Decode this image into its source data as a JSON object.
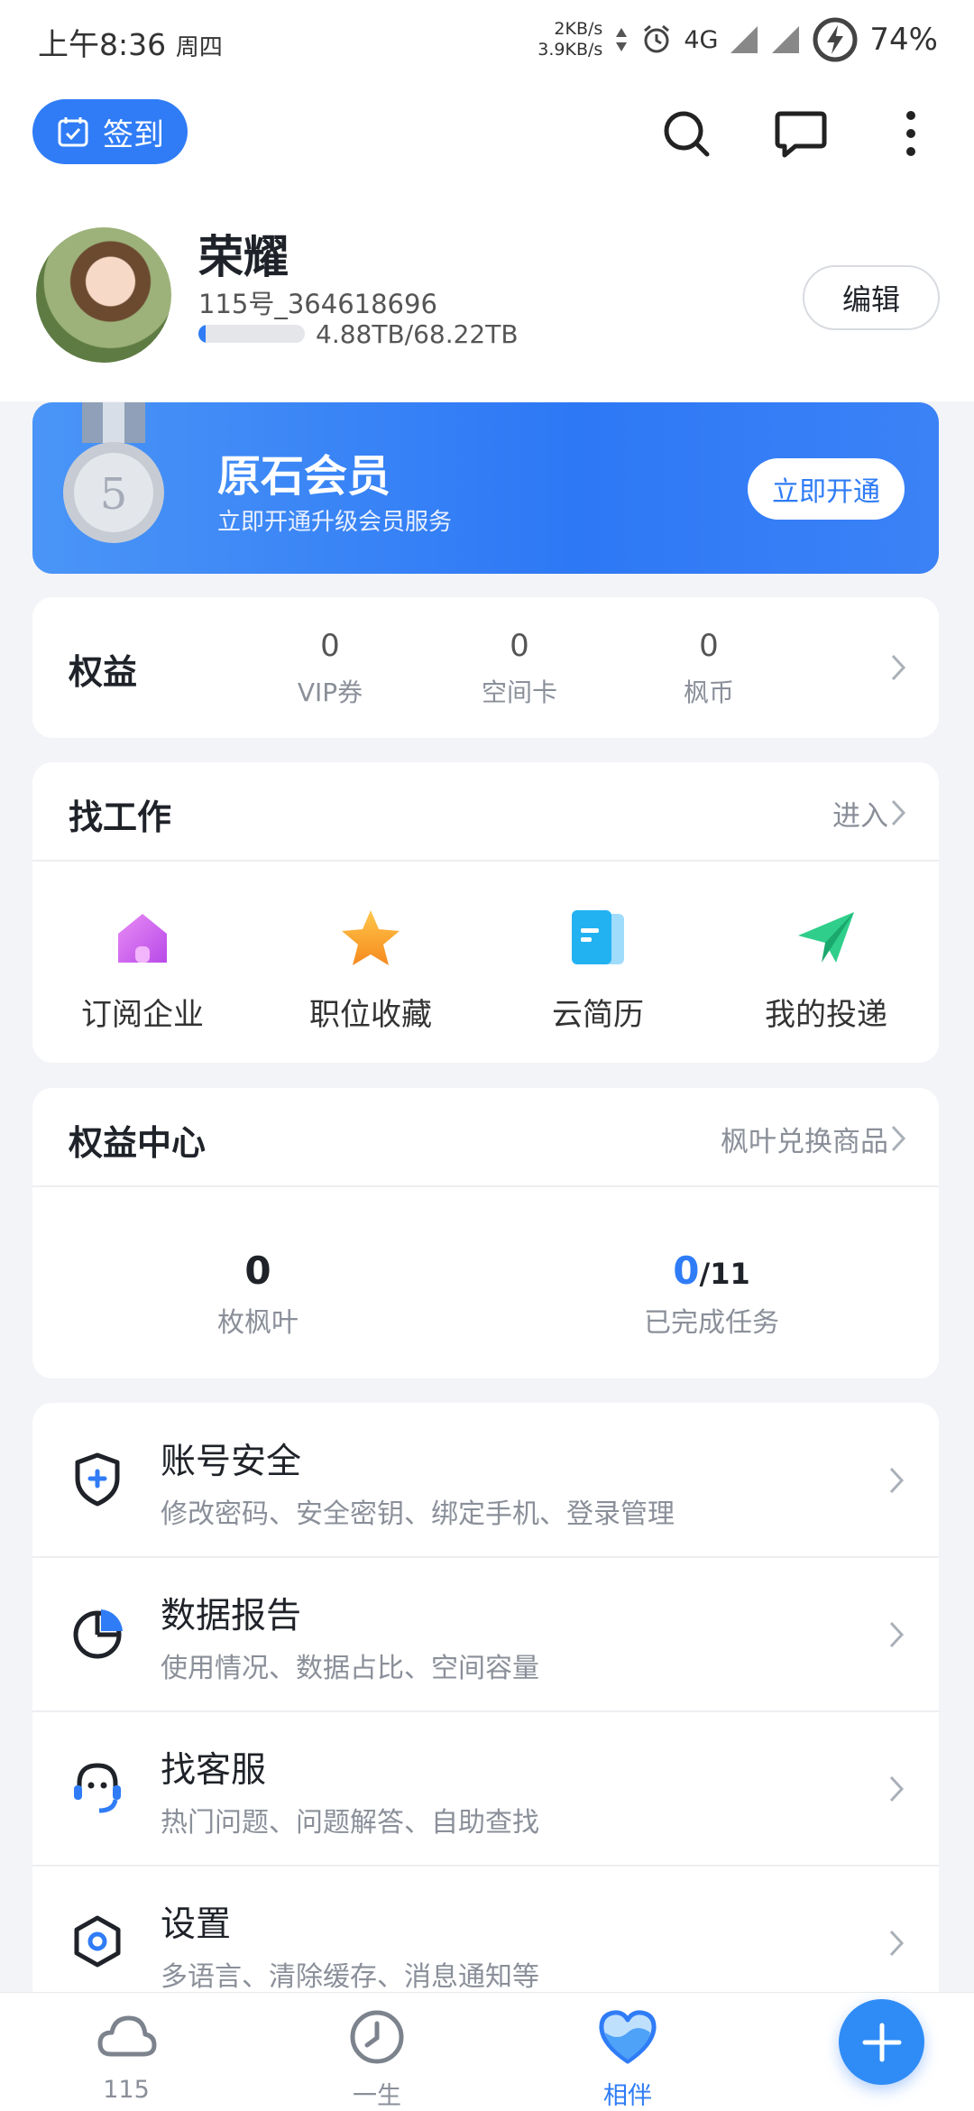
{
  "status_bar": {
    "time_prefix": "上午",
    "time": "8:36",
    "weekday": "周四",
    "net_up": "2KB/s",
    "net_down": "3.9KB/s",
    "network": "4G",
    "battery": "74%"
  },
  "header": {
    "checkin_label": "签到",
    "icons": [
      "search-icon",
      "message-icon",
      "more-icon"
    ],
    "user_name": "荣耀",
    "user_id": "115号_364618696",
    "storage_text": "4.88TB/68.22TB",
    "storage_used_fraction": 0.072,
    "edit_label": "编辑"
  },
  "vip_banner": {
    "title": "原石会员",
    "subtitle": "立即开通升级会员服务",
    "button_label": "立即开通",
    "medal_number": "5"
  },
  "rights": {
    "title": "权益",
    "items": [
      {
        "value": "0",
        "label": "VIP券"
      },
      {
        "value": "0",
        "label": "空间卡"
      },
      {
        "value": "0",
        "label": "枫币"
      }
    ]
  },
  "job": {
    "title": "找工作",
    "link": "进入",
    "items": [
      {
        "label": "订阅企业",
        "icon": "house-icon"
      },
      {
        "label": "职位收藏",
        "icon": "star-icon"
      },
      {
        "label": "云简历",
        "icon": "document-icon"
      },
      {
        "label": "我的投递",
        "icon": "paper-plane-icon"
      }
    ]
  },
  "rights_center": {
    "title": "权益中心",
    "link": "枫叶兑换商品",
    "leaves_value": "0",
    "leaves_label": "枚枫叶",
    "tasks_done": "0",
    "tasks_total": "/11",
    "tasks_label": "已完成任务"
  },
  "menu": [
    {
      "title": "账号安全",
      "desc": "修改密码、安全密钥、绑定手机、登录管理",
      "icon": "shield-plus-icon"
    },
    {
      "title": "数据报告",
      "desc": "使用情况、数据占比、空间容量",
      "icon": "pie-chart-icon"
    },
    {
      "title": "找客服",
      "desc": "热门问题、问题解答、自助查找",
      "icon": "headset-icon"
    },
    {
      "title": "设置",
      "desc": "多语言、清除缓存、消息通知等",
      "icon": "settings-hexagon-icon"
    }
  ],
  "tabbar": {
    "tabs": [
      {
        "label": "115",
        "icon": "cloud-icon"
      },
      {
        "label": "一生",
        "icon": "clock-icon"
      },
      {
        "label": "相伴",
        "icon": "heart-icon",
        "active": true
      }
    ],
    "fab_icon": "plus-icon"
  },
  "colors": {
    "accent": "#2f7cf6",
    "background": "#f3f4f7",
    "text_primary": "#1f2329",
    "text_secondary": "#8a8f99"
  }
}
